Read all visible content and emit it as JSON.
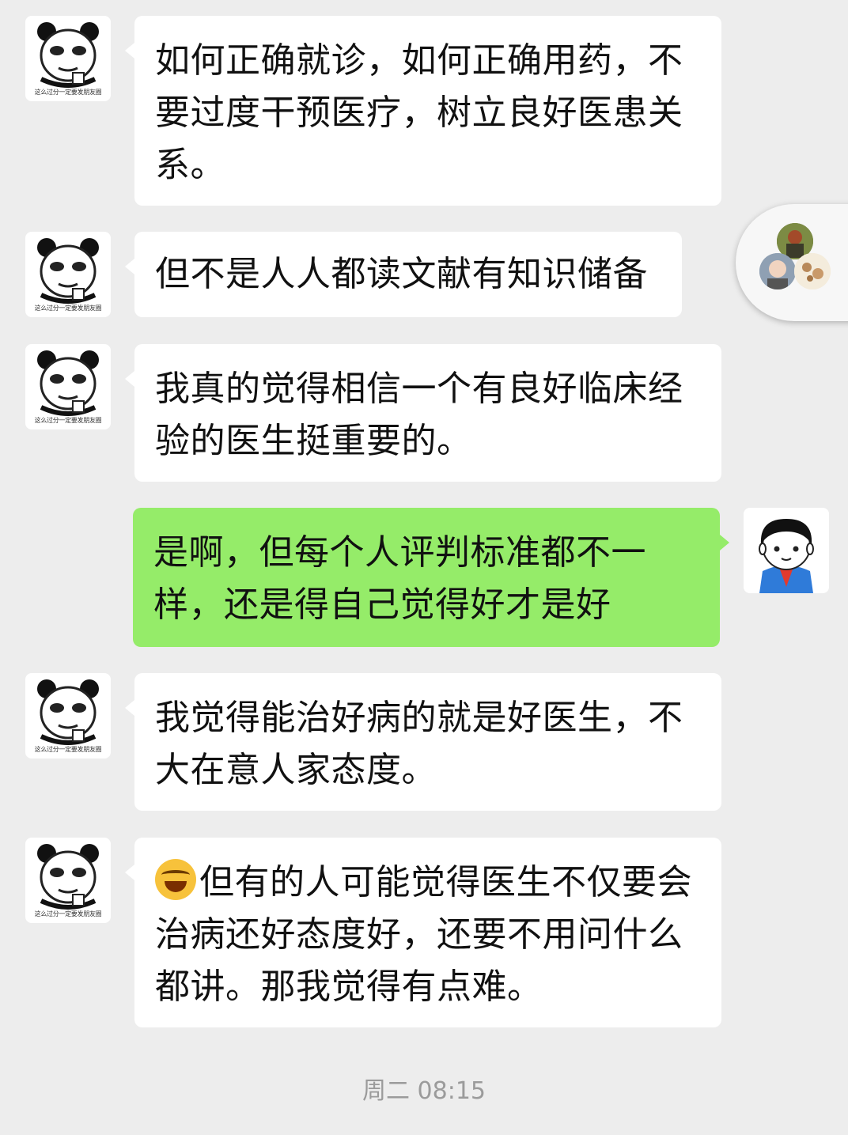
{
  "sender_caption": "这么过分一定要发朋友圈",
  "messages": [
    {
      "text": "如何正确就诊，如何正确用药，不要过度干预医疗，树立良好医患关系。"
    },
    {
      "text": "但不是人人都读文献有知识储备"
    },
    {
      "text": "我真的觉得相信一个有良好临床经验的医生挺重要的。"
    },
    {
      "text": "是啊，但每个人评判标准都不一样，还是得自己觉得好才是好"
    },
    {
      "text": "我觉得能治好病的就是好医生，不大在意人家态度。"
    },
    {
      "emoji": "joy-tears-emoji",
      "text": "但有的人可能觉得医生不仅要会治病还好态度好，还要不用问什么都讲。那我觉得有点难。"
    }
  ],
  "timestamp": "周二 08:15",
  "colors": {
    "background": "#ededed",
    "incoming_bubble": "#ffffff",
    "outgoing_bubble": "#95ec69",
    "timestamp": "#9b9b9b"
  }
}
